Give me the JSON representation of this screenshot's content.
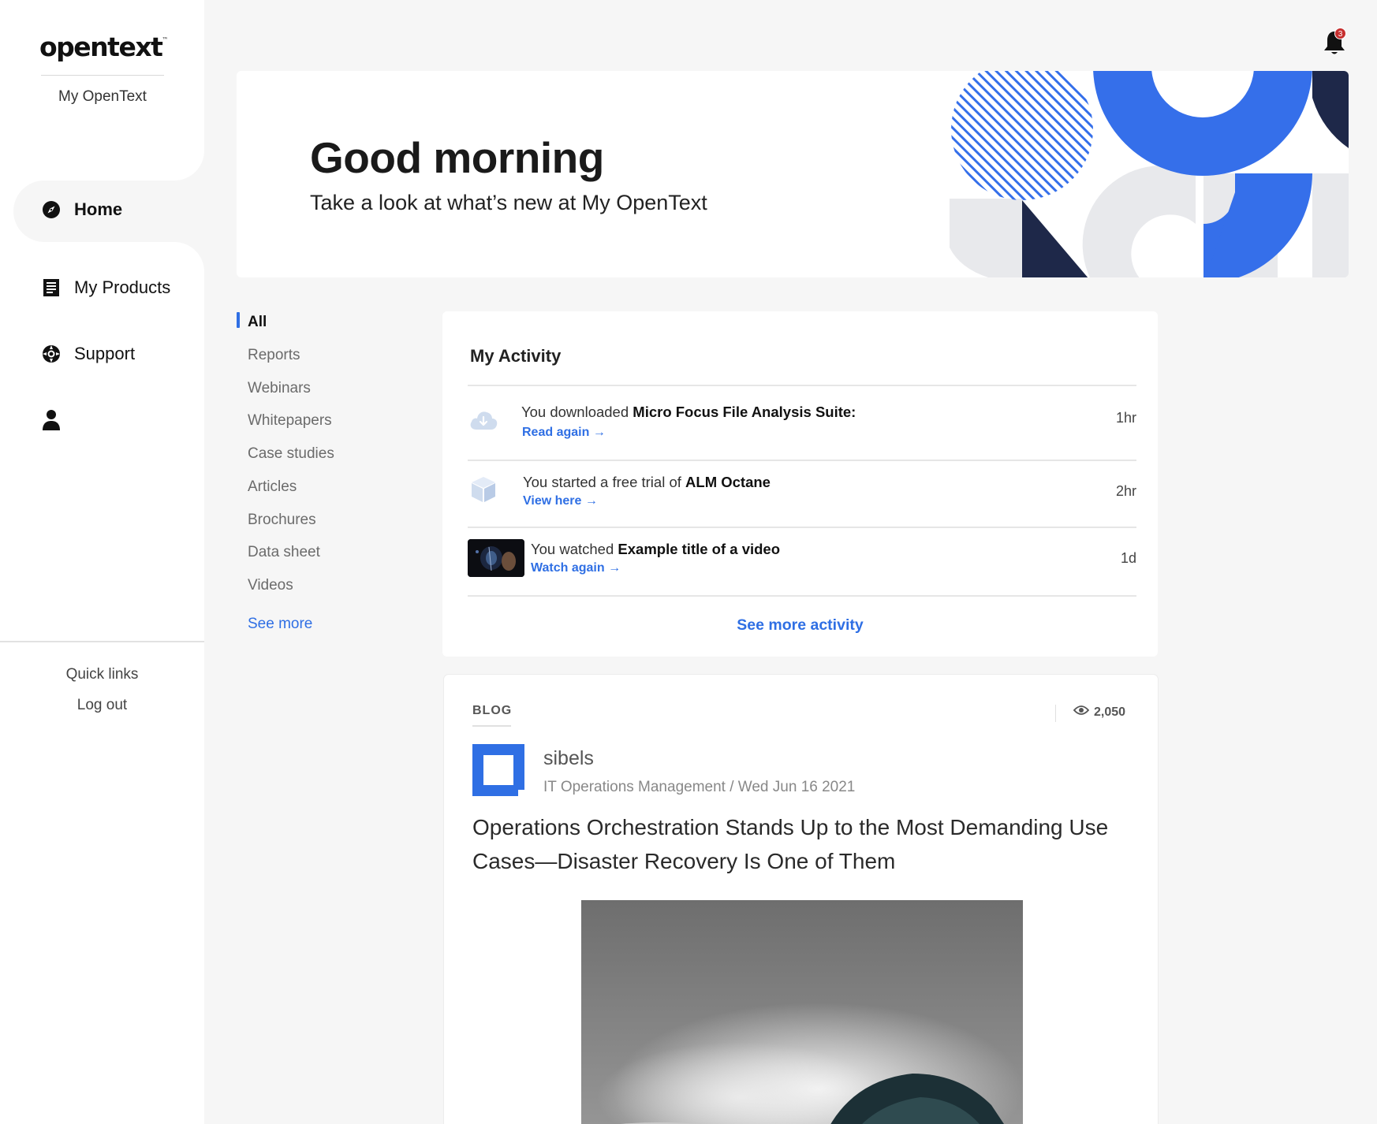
{
  "brand": {
    "logo": "opentext",
    "tm": "™",
    "subtitle": "My OpenText"
  },
  "nav": {
    "home": "Home",
    "products": "My Products",
    "support": "Support"
  },
  "sidebar_footer": {
    "quick_links": "Quick links",
    "logout": "Log out"
  },
  "notifications": {
    "count": "3"
  },
  "hero": {
    "title": "Good morning",
    "subtitle": "Take a look at what’s new at My OpenText"
  },
  "filters": {
    "items": [
      "All",
      "Reports",
      "Webinars",
      "Whitepapers",
      "Case studies",
      "Articles",
      "Brochures",
      "Data sheet",
      "Videos"
    ],
    "active": "All",
    "see_more": "See more"
  },
  "activity": {
    "title": "My Activity",
    "rows": [
      {
        "prefix": "You downloaded ",
        "item": "Micro Focus File Analysis Suite:",
        "link": "Read again",
        "time": "1hr",
        "icon": "cloud-download-icon"
      },
      {
        "prefix": "You started a free trial of ",
        "item": "ALM Octane",
        "link": "View here",
        "time": "2hr",
        "icon": "cube-icon"
      },
      {
        "prefix": "You watched ",
        "item": "Example title of a video",
        "link": "Watch again",
        "time": "1d",
        "icon": "video-thumbnail"
      }
    ],
    "see_more": "See more activity"
  },
  "blog": {
    "tag": "BLOG",
    "views": "2,050",
    "author": "sibels",
    "meta": "IT Operations Management / Wed Jun 16 2021",
    "title": "Operations Orchestration Stands Up to the Most Demanding Use Cases—Disaster Recovery Is One of Them"
  },
  "colors": {
    "accent": "#2f6fe4",
    "navy": "#1e2849",
    "art_blue": "#356fea",
    "art_gray": "#e8e9ec",
    "badge": "#c62f2f"
  }
}
